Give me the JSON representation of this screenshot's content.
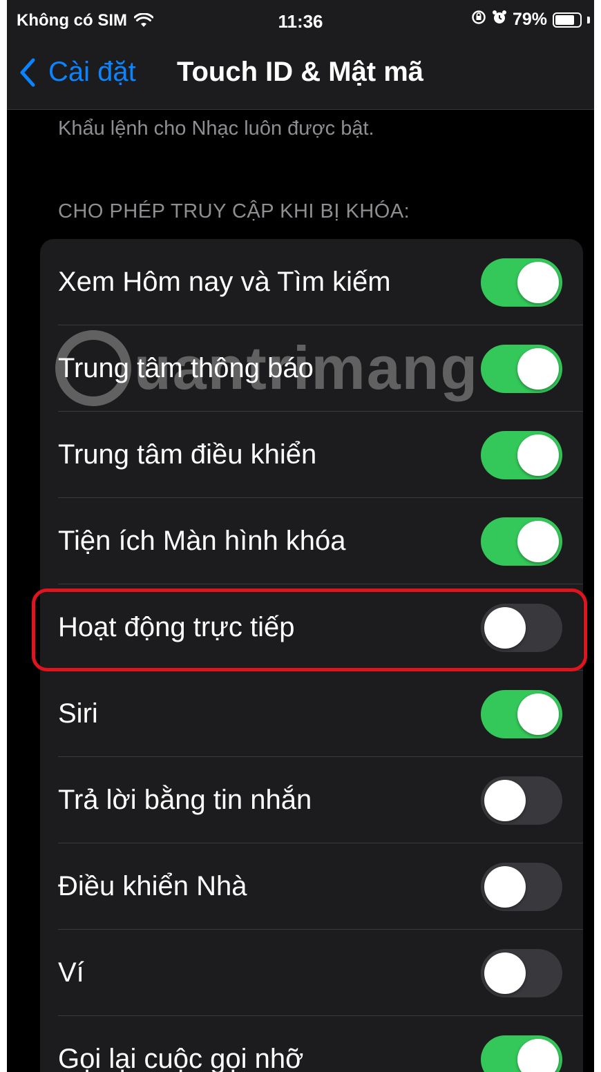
{
  "status_bar": {
    "carrier": "Không có SIM",
    "time": "11:36",
    "battery": "79%",
    "battery_level": 0.79,
    "icons": [
      "wifi-icon",
      "orientation-lock-icon",
      "alarm-icon",
      "battery-icon"
    ]
  },
  "nav": {
    "back_label": "Cài đặt",
    "title": "Touch ID & Mật mã"
  },
  "footer_note": "Khẩu lệnh cho Nhạc luôn được bật.",
  "section_header": "CHO PHÉP TRUY CẬP KHI BỊ KHÓA:",
  "watermark": "uantrimang",
  "rows": [
    {
      "label": "Xem Hôm nay và Tìm kiếm",
      "on": true
    },
    {
      "label": "Trung tâm thông báo",
      "on": true
    },
    {
      "label": "Trung tâm điều khiển",
      "on": true
    },
    {
      "label": "Tiện ích Màn hình khóa",
      "on": true
    },
    {
      "label": "Hoạt động trực tiếp",
      "on": false
    },
    {
      "label": "Siri",
      "on": true
    },
    {
      "label": "Trả lời bằng tin nhắn",
      "on": false
    },
    {
      "label": "Điều khiển Nhà",
      "on": false
    },
    {
      "label": "Ví",
      "on": false
    },
    {
      "label": "Gọi lại cuộc gọi nhỡ",
      "on": true
    }
  ],
  "colors": {
    "accent": "#0a84ff",
    "toggle_on": "#34c759",
    "toggle_off": "#39393d",
    "highlight": "#e0141e"
  }
}
